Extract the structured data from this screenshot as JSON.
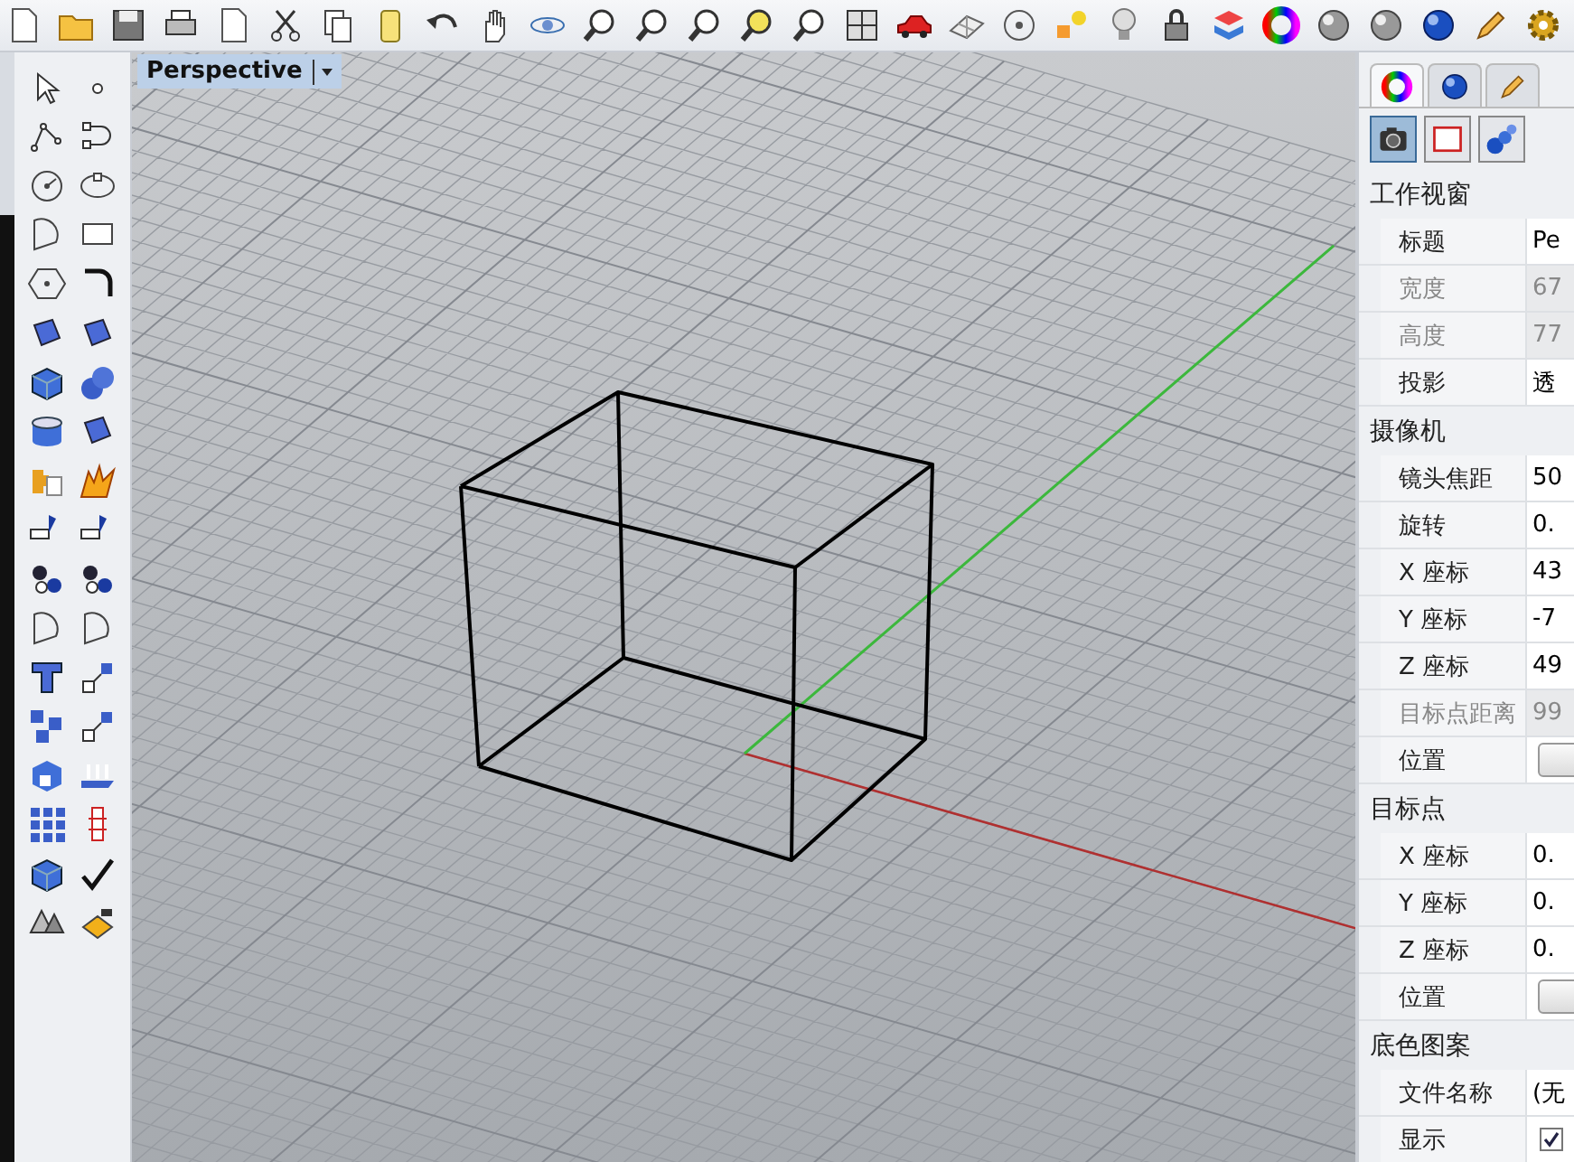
{
  "viewport": {
    "title": "Perspective"
  },
  "panel": {
    "tabs": [
      {
        "kind": "color",
        "selected": true
      },
      {
        "kind": "material",
        "selected": false
      },
      {
        "kind": "brush",
        "selected": false
      }
    ],
    "buttons": [
      {
        "kind": "camera",
        "selected": true
      },
      {
        "kind": "frame",
        "selected": false
      },
      {
        "kind": "spheres",
        "selected": false
      }
    ],
    "sections": [
      {
        "title": "工作视窗",
        "rows": [
          {
            "kind": "text",
            "label": "标题",
            "value": "Pe",
            "disabled": false
          },
          {
            "kind": "text",
            "label": "宽度",
            "value": "67",
            "disabled": true
          },
          {
            "kind": "text",
            "label": "高度",
            "value": "77",
            "disabled": true
          },
          {
            "kind": "text",
            "label": "投影",
            "value": "透",
            "disabled": false
          }
        ]
      },
      {
        "title": "摄像机",
        "rows": [
          {
            "kind": "text",
            "label": "镜头焦距",
            "value": "50",
            "disabled": false
          },
          {
            "kind": "text",
            "label": "旋转",
            "value": "0.",
            "disabled": false
          },
          {
            "kind": "text",
            "label": "X 座标",
            "value": "43",
            "disabled": false
          },
          {
            "kind": "text",
            "label": "Y 座标",
            "value": "-7",
            "disabled": false
          },
          {
            "kind": "text",
            "label": "Z 座标",
            "value": "49",
            "disabled": false
          },
          {
            "kind": "text",
            "label": "目标点距离",
            "value": "99",
            "disabled": true
          },
          {
            "kind": "button",
            "label": "位置",
            "disabled": false
          }
        ]
      },
      {
        "title": "目标点",
        "rows": [
          {
            "kind": "text",
            "label": "X 座标",
            "value": "0.",
            "disabled": false
          },
          {
            "kind": "text",
            "label": "Y 座标",
            "value": "0.",
            "disabled": false
          },
          {
            "kind": "text",
            "label": "Z 座标",
            "value": "0.",
            "disabled": false
          },
          {
            "kind": "button",
            "label": "位置",
            "disabled": false
          }
        ]
      },
      {
        "title": "底色图案",
        "rows": [
          {
            "kind": "text",
            "label": "文件名称",
            "value": "(无",
            "disabled": false
          },
          {
            "kind": "checkbox",
            "label": "显示",
            "checked": true,
            "disabled": false
          }
        ]
      }
    ]
  }
}
